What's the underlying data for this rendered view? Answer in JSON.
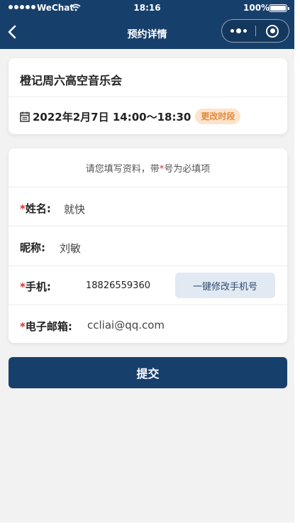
{
  "status_bar": {
    "carrier": "WeChat",
    "time": "18:16",
    "battery": "100%"
  },
  "nav": {
    "title": "预约详情"
  },
  "event": {
    "title": "橙记周六高空音乐会",
    "datetime": "2022年2月7日 14:00～18:30",
    "change_label": "更改时段"
  },
  "form": {
    "hint_prefix": "请您填写资料，带",
    "hint_star": "*",
    "hint_suffix": "号为必填项",
    "name_label": "姓名:",
    "name_value": "就快",
    "nickname_label": "昵称:",
    "nickname_value": "刘敏",
    "phone_label": "手机:",
    "phone_value": "18826559360",
    "modify_phone_label": "一键修改手机号",
    "email_label": "电子邮箱:",
    "email_value": "ccliai@qq.com",
    "required_mark": "*"
  },
  "submit_label": "提交",
  "colors": {
    "primary": "#173f6b",
    "required": "#d6302b",
    "accent_orange": "#e48a3c"
  }
}
